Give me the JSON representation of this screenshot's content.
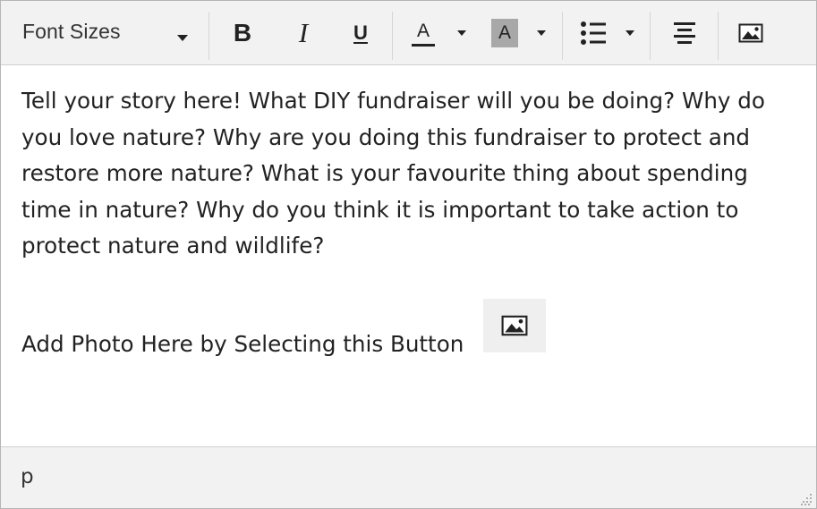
{
  "toolbar": {
    "font_sizes_label": "Font Sizes",
    "bold_label": "B",
    "italic_label": "I",
    "underline_label": "U",
    "text_color_label": "A",
    "background_color_label": "A",
    "colors": {
      "text_color_bar": "#222222",
      "background_color_fill": "#a8a8a8",
      "toolbar_bg": "#f2f2f2"
    },
    "icons": [
      "chevron-down-icon",
      "bold-icon",
      "italic-icon",
      "underline-icon",
      "text-color-icon",
      "background-color-icon",
      "bullet-list-icon",
      "align-center-icon",
      "image-icon"
    ]
  },
  "content": {
    "paragraph": "Tell your story here! What DIY fundraiser will you be doing? Why do you love nature? Why are you doing this fundraiser to protect and restore more nature? What is your favourite thing about spending time in nature? Why do you think it is important to take action to protect nature and wildlife?",
    "photo_instruction": "Add Photo Here by Selecting this Button"
  },
  "statusbar": {
    "element_path": "p"
  }
}
